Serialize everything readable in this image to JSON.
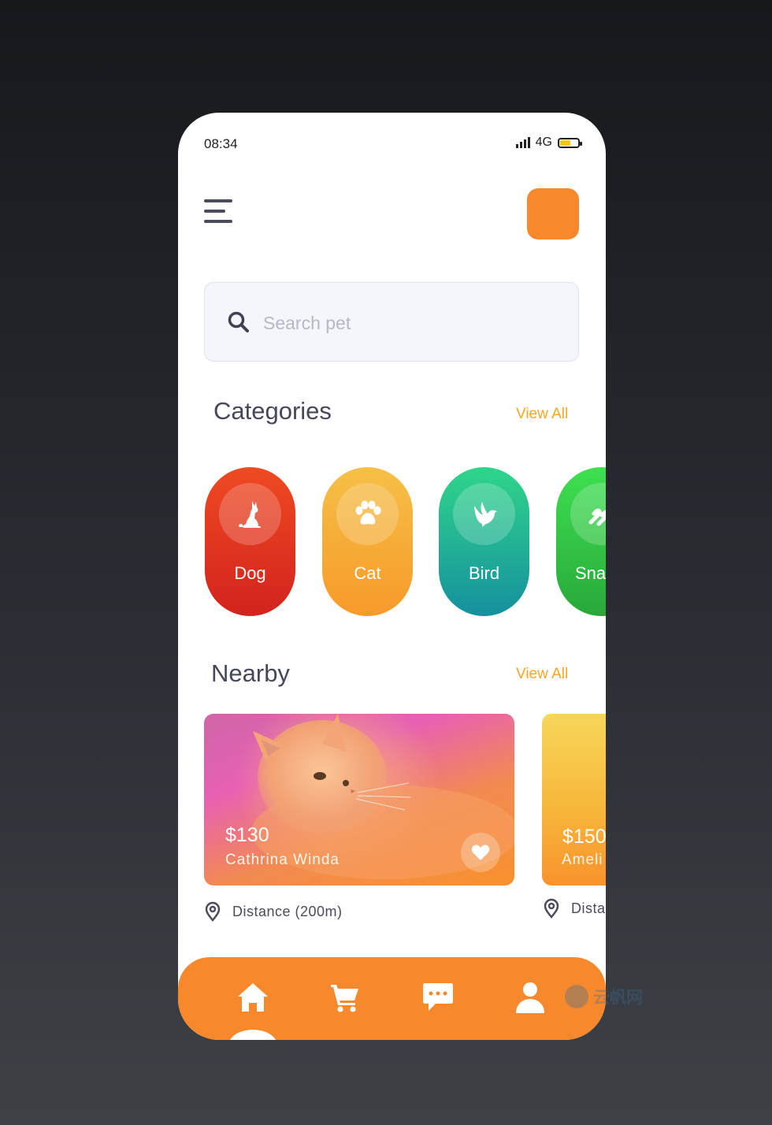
{
  "status_bar": {
    "time": "08:34",
    "network": "4G",
    "battery_color": "#f5c518"
  },
  "header": {
    "menu_icon": "hamburger-menu-icon",
    "profile_button_color": "#f7892c"
  },
  "search": {
    "placeholder": "Search pet",
    "value": "",
    "icon": "search-icon"
  },
  "categories": {
    "title": "Categories",
    "view_all": "View All",
    "items": [
      {
        "label": "Dog",
        "icon": "dog-icon"
      },
      {
        "label": "Cat",
        "icon": "paw-icon"
      },
      {
        "label": "Bird",
        "icon": "bird-icon"
      },
      {
        "label": "Sna",
        "icon": "snake-icon"
      }
    ]
  },
  "nearby": {
    "title": "Nearby",
    "view_all": "View All",
    "cards": [
      {
        "price": "$130",
        "owner": "Cathrina Winda",
        "distance": "Distance (200m)",
        "image": "kitten-photo",
        "favorite_icon": "heart-icon"
      },
      {
        "price": "$150",
        "owner": "Ameli",
        "distance": "Dista"
      }
    ]
  },
  "bottom_nav": {
    "items": [
      {
        "name": "home",
        "icon": "home-icon",
        "active": true
      },
      {
        "name": "cart",
        "icon": "cart-icon",
        "active": false
      },
      {
        "name": "messages",
        "icon": "chat-icon",
        "active": false
      },
      {
        "name": "profile",
        "icon": "user-icon",
        "active": false
      }
    ]
  },
  "watermark": {
    "text": "云帆网"
  },
  "colors": {
    "accent": "#f7892c",
    "link": "#f5a623",
    "dog": "#e3361f",
    "cat": "#f6ad35",
    "bird": "#22b592",
    "snake": "#33c846"
  }
}
